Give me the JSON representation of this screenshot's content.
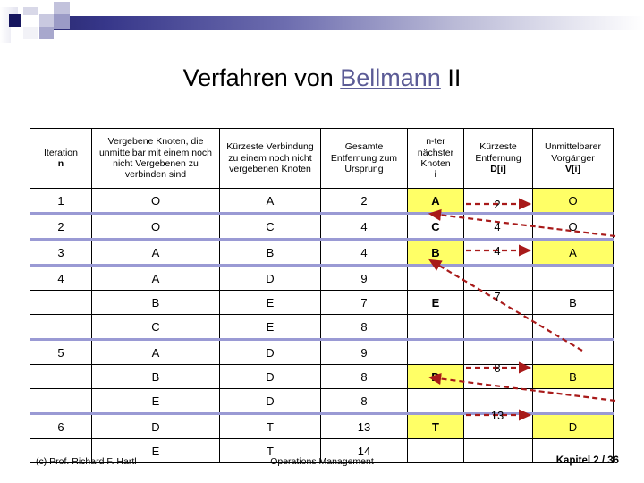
{
  "title": {
    "before": "Verfahren von ",
    "link": "Bellmann",
    "after": " II"
  },
  "colors": {
    "highlight": "#ffff66",
    "arrow": "#a81a1a",
    "separator": "#9a9ad4",
    "band_start": "#2a2a72",
    "link": "#5b5b96"
  },
  "table": {
    "headers": [
      {
        "line1": "Iteration",
        "line2": "n",
        "bold2": true
      },
      {
        "line1": "Vergebene Knoten, die unmittelbar mit einem noch nicht Vergebenen zu verbinden sind"
      },
      {
        "line1": "Kürzeste Verbindung zu einem noch nicht vergebenen Knoten"
      },
      {
        "line1": "Gesamte Entfernung zum Ursprung"
      },
      {
        "line1": "n-ter nächster Knoten",
        "line2": "i",
        "bold2": true
      },
      {
        "line1": "Kürzeste Entfernung",
        "line2": "D[i]",
        "bold2": true
      },
      {
        "line1": "Unmittelbarer Vorgänger",
        "line2": "V[i]",
        "bold2": true
      }
    ],
    "rows": [
      {
        "iteration": "1",
        "assigned": "O",
        "shortest_conn": "A",
        "total_dist": "2",
        "nth_node": "A",
        "nth_hl": true,
        "d_i": "",
        "d_hl": false,
        "v_i": "O",
        "v_hl": true,
        "sep": true
      },
      {
        "iteration": "2",
        "assigned": "O",
        "shortest_conn": "C",
        "total_dist": "4",
        "nth_node": "C",
        "nth_hl": false,
        "d_i": "",
        "d_hl": false,
        "v_i": "O",
        "v_hl": false,
        "sep": true
      },
      {
        "iteration": "3",
        "assigned": "A",
        "shortest_conn": "B",
        "total_dist": "4",
        "nth_node": "B",
        "nth_hl": true,
        "d_i": "",
        "d_hl": false,
        "v_i": "A",
        "v_hl": true,
        "sep": true
      },
      {
        "iteration": "4",
        "assigned": "A",
        "shortest_conn": "D",
        "total_dist": "9",
        "nth_node": "",
        "nth_hl": false,
        "d_i": "",
        "d_hl": false,
        "v_i": "",
        "v_hl": false,
        "sep": false
      },
      {
        "iteration": "",
        "assigned": "B",
        "shortest_conn": "E",
        "total_dist": "7",
        "nth_node": "E",
        "nth_hl": false,
        "d_i": "",
        "d_hl": false,
        "v_i": "B",
        "v_hl": false,
        "sep": false
      },
      {
        "iteration": "",
        "assigned": "C",
        "shortest_conn": "E",
        "total_dist": "8",
        "nth_node": "",
        "nth_hl": false,
        "d_i": "",
        "d_hl": false,
        "v_i": "",
        "v_hl": false,
        "sep": true
      },
      {
        "iteration": "5",
        "assigned": "A",
        "shortest_conn": "D",
        "total_dist": "9",
        "nth_node": "",
        "nth_hl": false,
        "d_i": "",
        "d_hl": false,
        "v_i": "",
        "v_hl": false,
        "sep": false
      },
      {
        "iteration": "",
        "assigned": "B",
        "shortest_conn": "D",
        "total_dist": "8",
        "nth_node": "D",
        "nth_hl": true,
        "d_i": "",
        "d_hl": false,
        "v_i": "B",
        "v_hl": true,
        "sep": false
      },
      {
        "iteration": "",
        "assigned": "E",
        "shortest_conn": "D",
        "total_dist": "8",
        "nth_node": "",
        "nth_hl": false,
        "d_i": "",
        "d_hl": false,
        "v_i": "",
        "v_hl": false,
        "sep": true
      },
      {
        "iteration": "6",
        "assigned": "D",
        "shortest_conn": "T",
        "total_dist": "13",
        "nth_node": "T",
        "nth_hl": true,
        "d_i": "",
        "d_hl": false,
        "v_i": "D",
        "v_hl": true,
        "sep": false
      },
      {
        "iteration": "",
        "assigned": "E",
        "shortest_conn": "T",
        "total_dist": "14",
        "nth_node": "",
        "nth_hl": false,
        "d_i": "",
        "d_hl": false,
        "v_i": "",
        "v_hl": false,
        "sep": false
      }
    ],
    "arrow_labels": [
      "2",
      "4",
      "4",
      "7",
      "8",
      "13"
    ]
  },
  "footer": {
    "left": "(c) Prof. Richard F. Hartl",
    "center": "Operations Management",
    "right": "Kapitel 2 / 36"
  }
}
